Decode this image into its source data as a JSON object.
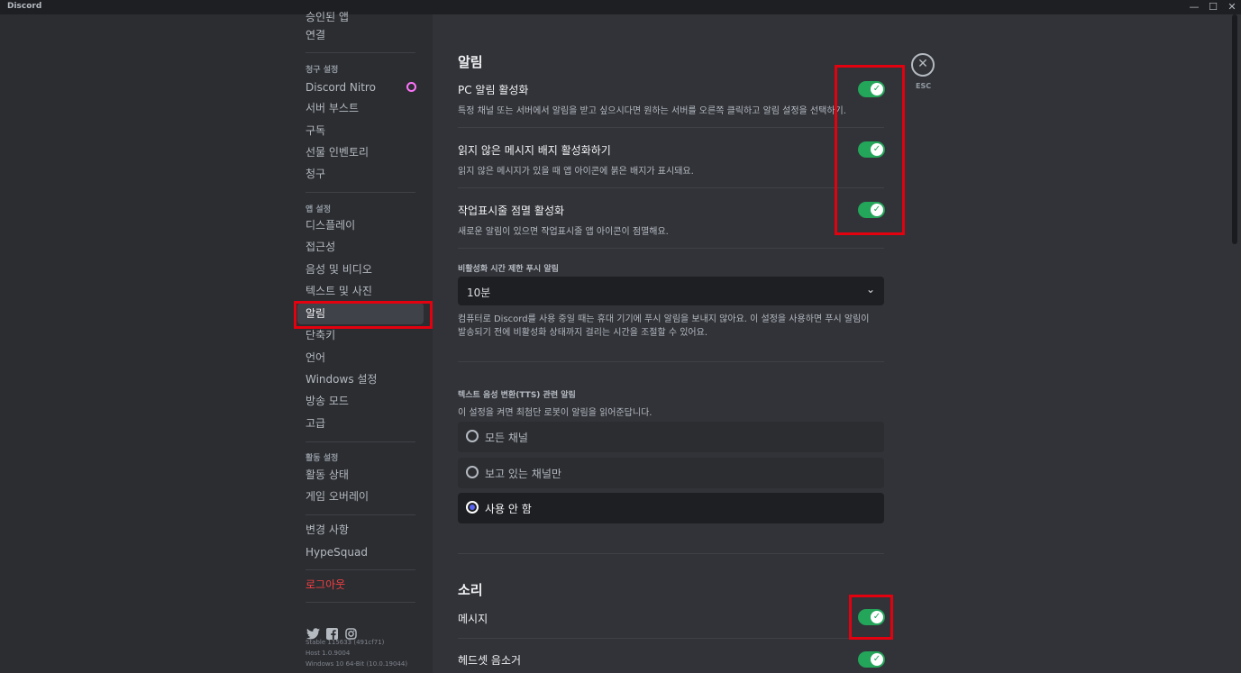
{
  "window": {
    "title": "Discord",
    "min": "—",
    "max": "☐",
    "close": "✕"
  },
  "sidebar": {
    "top_partial": "승인된 앱",
    "connections": "연결",
    "billing_header": "청구 설정",
    "nitro": "Discord Nitro",
    "server_boost": "서버 부스트",
    "subscriptions": "구독",
    "gift_inventory": "선물 인벤토리",
    "billing": "청구",
    "app_header": "앱 설정",
    "display": "디스플레이",
    "accessibility": "접근성",
    "voice_video": "음성 및 비디오",
    "text_images": "텍스트 및 사진",
    "notifications": "알림",
    "keybinds": "단축키",
    "language": "언어",
    "windows_settings": "Windows 설정",
    "streamer_mode": "방송 모드",
    "advanced": "고급",
    "activity_header": "활동 설정",
    "activity_status": "활동 상태",
    "game_overlay": "게임 오버레이",
    "changelog": "변경 사항",
    "hypesquad": "HypeSquad",
    "logout": "로그아웃",
    "version_lines": [
      "Stable 115633 (491cf71)",
      "Host 1.0.9004",
      "Windows 10 64-Bit (10.0.19044)"
    ]
  },
  "main": {
    "notifications_title": "알림",
    "desktop_notif_title": "PC 알림 활성화",
    "desktop_notif_desc": "특정 채널 또는 서버에서 알림을 받고 싶으시다면 원하는 서버를 오른쪽 클릭하고 알림 설정을 선택하기.",
    "unread_badge_title": "읽지 않은 메시지 배지 활성화하기",
    "unread_badge_desc": "읽지 않은 메시지가 있을 때 앱 아이콘에 붉은 배지가 표시돼요.",
    "taskbar_flash_title": "작업표시줄 점멸 활성화",
    "taskbar_flash_desc": "새로운 알림이 있으면 작업표시줄 앱 아이콘이 점멸해요.",
    "push_timeout_label": "비활성화 시간 제한 푸시 알림",
    "push_timeout_value": "10분",
    "push_timeout_desc_1": "컴퓨터로 Discord를 사용 중일 때는 휴대 기기에 푸시 알림을 보내지 않아요. 이 설정을 사용하면 푸시 알림이",
    "push_timeout_desc_2": "발송되기 전에 비활성화 상태까지 걸리는 시간을 조절할 수 있어요.",
    "tts_label": "텍스트 음성 변환(TTS) 관련 알림",
    "tts_desc": "이 설정을 켜면 최첨단 로봇이 알림을 읽어준답니다.",
    "tts_options": [
      "모든 채널",
      "보고 있는 채널만",
      "사용 안 함"
    ],
    "tts_selected": "사용 안 함",
    "sounds_title": "소리",
    "sound_message": "메시지",
    "sound_deafen": "헤드셋 음소거",
    "toggles": {
      "desktop": true,
      "unread": true,
      "taskbar": true,
      "message": true,
      "deafen": true
    },
    "close_label": "ESC"
  },
  "colors": {
    "accent_green": "#23a55a",
    "danger_red": "#f23f43",
    "highlight_box": "#e3000f",
    "nitro_pink": "#ff73fa"
  }
}
